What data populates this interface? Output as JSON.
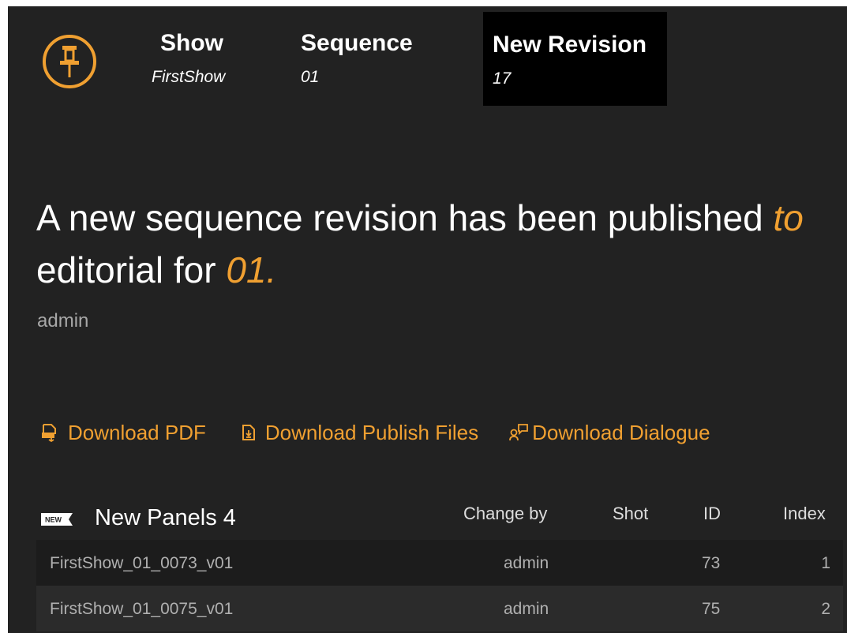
{
  "header": {
    "logo_icon": "pushpin-icon",
    "show": {
      "label": "Show",
      "value": "FirstShow"
    },
    "sequence": {
      "label": "Sequence",
      "value": "01"
    },
    "revision": {
      "label": "New Revision",
      "value": "17"
    }
  },
  "message": {
    "text_before": "A new sequence revision has been published ",
    "highlight_to": "to",
    "text_middle": " editorial for ",
    "highlight_seq": "01.",
    "author": "admin"
  },
  "actions": [
    {
      "label": "Download PDF",
      "icon": "pdf-download-icon"
    },
    {
      "label": "Download Publish Files",
      "icon": "file-download-icon"
    },
    {
      "label": "Download Dialogue",
      "icon": "dialogue-icon"
    }
  ],
  "panels": {
    "badge": "NEW",
    "title": "New Panels 4",
    "columns": {
      "change_by": "Change by",
      "shot": "Shot",
      "id": "ID",
      "index": "Index"
    },
    "rows": [
      {
        "name": "FirstShow_01_0073_v01",
        "change_by": "admin",
        "shot": "",
        "id": "73",
        "index": "1"
      },
      {
        "name": "FirstShow_01_0075_v01",
        "change_by": "admin",
        "shot": "",
        "id": "75",
        "index": "2"
      }
    ]
  },
  "colors": {
    "accent": "#f0a031",
    "background": "#222222",
    "active_tab": "#000000"
  }
}
